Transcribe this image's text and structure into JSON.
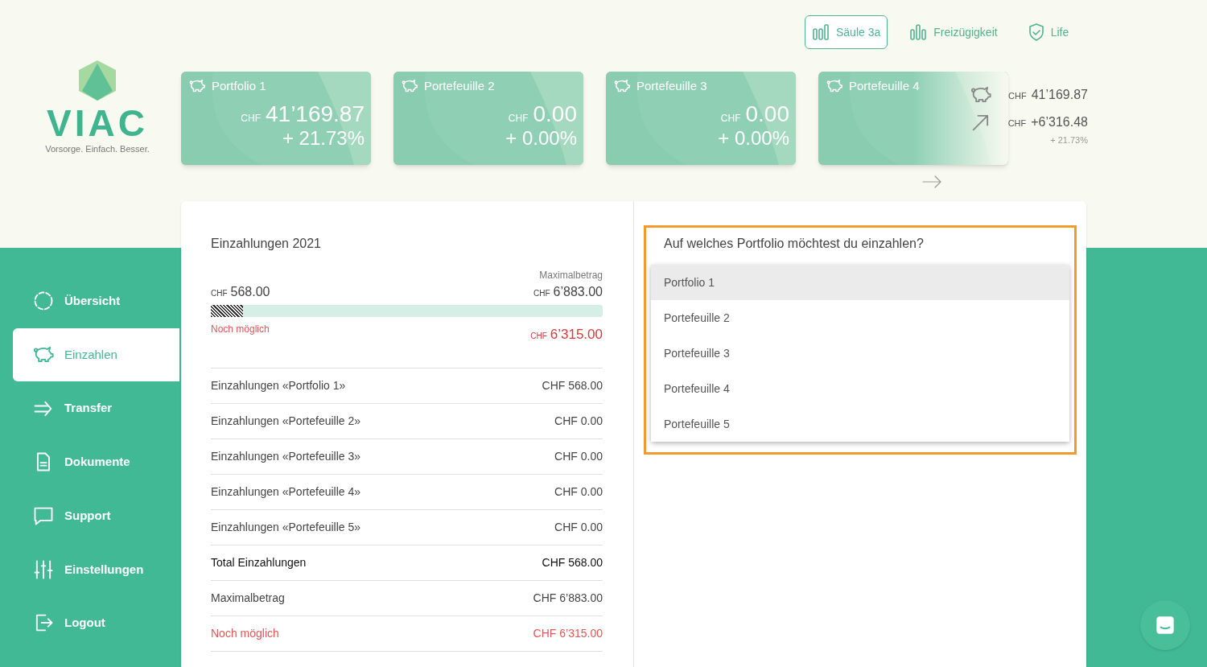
{
  "logo": {
    "wordmark": "VIAC",
    "tagline": "Vorsorge. Einfach. Besser."
  },
  "products": [
    {
      "label": "Säule 3a",
      "selected": true,
      "kind": "pillar"
    },
    {
      "label": "Freizügigkeit",
      "selected": false,
      "kind": "bars"
    },
    {
      "label": "Life",
      "selected": false,
      "kind": "shield"
    }
  ],
  "portfolio_cards": [
    {
      "title": "Portfolio 1",
      "currency": "CHF",
      "value": "41’169.87",
      "change": "+ 21.73%",
      "faded": false
    },
    {
      "title": "Portefeuille 2",
      "currency": "CHF",
      "value": "0.00",
      "change": "+ 0.00%",
      "faded": false
    },
    {
      "title": "Portefeuille 3",
      "currency": "CHF",
      "value": "0.00",
      "change": "+ 0.00%",
      "faded": false
    },
    {
      "title": "Portefeuille 4",
      "faded": true
    }
  ],
  "totals": {
    "currency": "CHF",
    "value": "41’169.87",
    "gain_currency": "CHF",
    "gain": "+6’316.48",
    "gain_percent": "+ 21.73%"
  },
  "sidebar": {
    "items": [
      {
        "label": "Übersicht",
        "selected": false
      },
      {
        "label": "Einzahlen",
        "selected": true
      },
      {
        "label": "Transfer",
        "selected": false
      },
      {
        "label": "Dokumente",
        "selected": false
      },
      {
        "label": "Support",
        "selected": false
      },
      {
        "label": "Einstellungen",
        "selected": false
      },
      {
        "label": "Logout",
        "selected": false
      }
    ]
  },
  "deposits": {
    "title": "Einzahlungen 2021",
    "max_label": "Maximalbetrag",
    "paid_currency": "CHF",
    "paid": "568.00",
    "max_currency": "CHF",
    "max": "6’883.00",
    "level": 0.083,
    "remaining_label": "Noch möglich",
    "remaining_currency": "CHF",
    "remaining": "6’315.00",
    "rows": [
      {
        "label": "Einzahlungen «Portfolio 1»",
        "amount": "CHF 568.00",
        "kind": "normal"
      },
      {
        "label": "Einzahlungen «Portefeuille 2»",
        "amount": "CHF 0.00",
        "kind": "normal"
      },
      {
        "label": "Einzahlungen «Portefeuille 3»",
        "amount": "CHF 0.00",
        "kind": "normal"
      },
      {
        "label": "Einzahlungen «Portefeuille 4»",
        "amount": "CHF 0.00",
        "kind": "normal"
      },
      {
        "label": "Einzahlungen «Portefeuille 5»",
        "amount": "CHF 0.00",
        "kind": "normal"
      },
      {
        "label": "Total Einzahlungen",
        "amount": "CHF 568.00",
        "kind": "total"
      },
      {
        "label": "Maximalbetrag",
        "amount": "CHF 6’883.00",
        "kind": "normal"
      },
      {
        "label": "Noch möglich",
        "amount": "CHF 6’315.00",
        "kind": "warning"
      }
    ]
  },
  "portfolio_select": {
    "question": "Auf welches Portfolio möchtest du einzahlen?",
    "options": [
      {
        "label": "Portfolio 1",
        "selected": true
      },
      {
        "label": "Portefeuille 2",
        "selected": false
      },
      {
        "label": "Portefeuille 3",
        "selected": false
      },
      {
        "label": "Portefeuille 4",
        "selected": false
      },
      {
        "label": "Portefeuille 5",
        "selected": false
      }
    ]
  }
}
